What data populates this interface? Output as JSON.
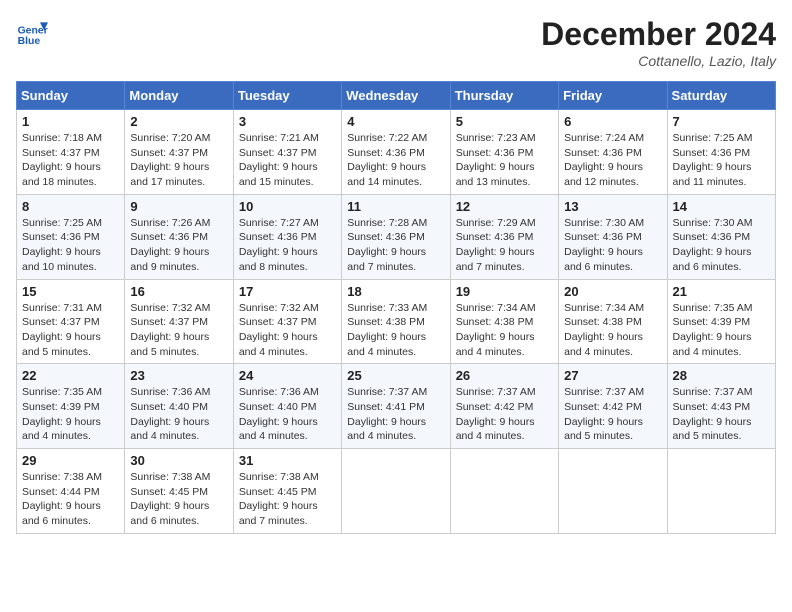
{
  "header": {
    "logo_line1": "General",
    "logo_line2": "Blue",
    "month": "December 2024",
    "location": "Cottanello, Lazio, Italy"
  },
  "weekdays": [
    "Sunday",
    "Monday",
    "Tuesday",
    "Wednesday",
    "Thursday",
    "Friday",
    "Saturday"
  ],
  "weeks": [
    [
      {
        "day": "1",
        "sunrise": "7:18 AM",
        "sunset": "4:37 PM",
        "daylight": "9 hours and 18 minutes."
      },
      {
        "day": "2",
        "sunrise": "7:20 AM",
        "sunset": "4:37 PM",
        "daylight": "9 hours and 17 minutes."
      },
      {
        "day": "3",
        "sunrise": "7:21 AM",
        "sunset": "4:37 PM",
        "daylight": "9 hours and 15 minutes."
      },
      {
        "day": "4",
        "sunrise": "7:22 AM",
        "sunset": "4:36 PM",
        "daylight": "9 hours and 14 minutes."
      },
      {
        "day": "5",
        "sunrise": "7:23 AM",
        "sunset": "4:36 PM",
        "daylight": "9 hours and 13 minutes."
      },
      {
        "day": "6",
        "sunrise": "7:24 AM",
        "sunset": "4:36 PM",
        "daylight": "9 hours and 12 minutes."
      },
      {
        "day": "7",
        "sunrise": "7:25 AM",
        "sunset": "4:36 PM",
        "daylight": "9 hours and 11 minutes."
      }
    ],
    [
      {
        "day": "8",
        "sunrise": "7:25 AM",
        "sunset": "4:36 PM",
        "daylight": "9 hours and 10 minutes."
      },
      {
        "day": "9",
        "sunrise": "7:26 AM",
        "sunset": "4:36 PM",
        "daylight": "9 hours and 9 minutes."
      },
      {
        "day": "10",
        "sunrise": "7:27 AM",
        "sunset": "4:36 PM",
        "daylight": "9 hours and 8 minutes."
      },
      {
        "day": "11",
        "sunrise": "7:28 AM",
        "sunset": "4:36 PM",
        "daylight": "9 hours and 7 minutes."
      },
      {
        "day": "12",
        "sunrise": "7:29 AM",
        "sunset": "4:36 PM",
        "daylight": "9 hours and 7 minutes."
      },
      {
        "day": "13",
        "sunrise": "7:30 AM",
        "sunset": "4:36 PM",
        "daylight": "9 hours and 6 minutes."
      },
      {
        "day": "14",
        "sunrise": "7:30 AM",
        "sunset": "4:36 PM",
        "daylight": "9 hours and 6 minutes."
      }
    ],
    [
      {
        "day": "15",
        "sunrise": "7:31 AM",
        "sunset": "4:37 PM",
        "daylight": "9 hours and 5 minutes."
      },
      {
        "day": "16",
        "sunrise": "7:32 AM",
        "sunset": "4:37 PM",
        "daylight": "9 hours and 5 minutes."
      },
      {
        "day": "17",
        "sunrise": "7:32 AM",
        "sunset": "4:37 PM",
        "daylight": "9 hours and 4 minutes."
      },
      {
        "day": "18",
        "sunrise": "7:33 AM",
        "sunset": "4:38 PM",
        "daylight": "9 hours and 4 minutes."
      },
      {
        "day": "19",
        "sunrise": "7:34 AM",
        "sunset": "4:38 PM",
        "daylight": "9 hours and 4 minutes."
      },
      {
        "day": "20",
        "sunrise": "7:34 AM",
        "sunset": "4:38 PM",
        "daylight": "9 hours and 4 minutes."
      },
      {
        "day": "21",
        "sunrise": "7:35 AM",
        "sunset": "4:39 PM",
        "daylight": "9 hours and 4 minutes."
      }
    ],
    [
      {
        "day": "22",
        "sunrise": "7:35 AM",
        "sunset": "4:39 PM",
        "daylight": "9 hours and 4 minutes."
      },
      {
        "day": "23",
        "sunrise": "7:36 AM",
        "sunset": "4:40 PM",
        "daylight": "9 hours and 4 minutes."
      },
      {
        "day": "24",
        "sunrise": "7:36 AM",
        "sunset": "4:40 PM",
        "daylight": "9 hours and 4 minutes."
      },
      {
        "day": "25",
        "sunrise": "7:37 AM",
        "sunset": "4:41 PM",
        "daylight": "9 hours and 4 minutes."
      },
      {
        "day": "26",
        "sunrise": "7:37 AM",
        "sunset": "4:42 PM",
        "daylight": "9 hours and 4 minutes."
      },
      {
        "day": "27",
        "sunrise": "7:37 AM",
        "sunset": "4:42 PM",
        "daylight": "9 hours and 5 minutes."
      },
      {
        "day": "28",
        "sunrise": "7:37 AM",
        "sunset": "4:43 PM",
        "daylight": "9 hours and 5 minutes."
      }
    ],
    [
      {
        "day": "29",
        "sunrise": "7:38 AM",
        "sunset": "4:44 PM",
        "daylight": "9 hours and 6 minutes."
      },
      {
        "day": "30",
        "sunrise": "7:38 AM",
        "sunset": "4:45 PM",
        "daylight": "9 hours and 6 minutes."
      },
      {
        "day": "31",
        "sunrise": "7:38 AM",
        "sunset": "4:45 PM",
        "daylight": "9 hours and 7 minutes."
      },
      null,
      null,
      null,
      null
    ]
  ]
}
